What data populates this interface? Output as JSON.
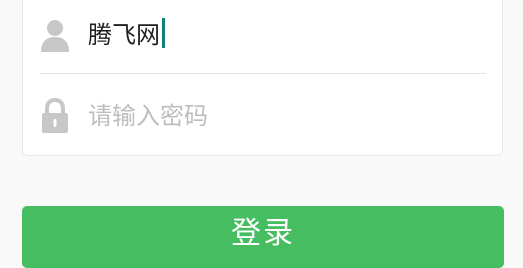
{
  "login_form": {
    "username": {
      "value": "腾飞网",
      "icon": "user-icon"
    },
    "password": {
      "placeholder": "请输入密码",
      "icon": "lock-icon"
    },
    "submit_label": "登录"
  },
  "colors": {
    "icon_gray": "#c7c7c7",
    "button_green": "#45bd60",
    "caret": "#11807a"
  }
}
